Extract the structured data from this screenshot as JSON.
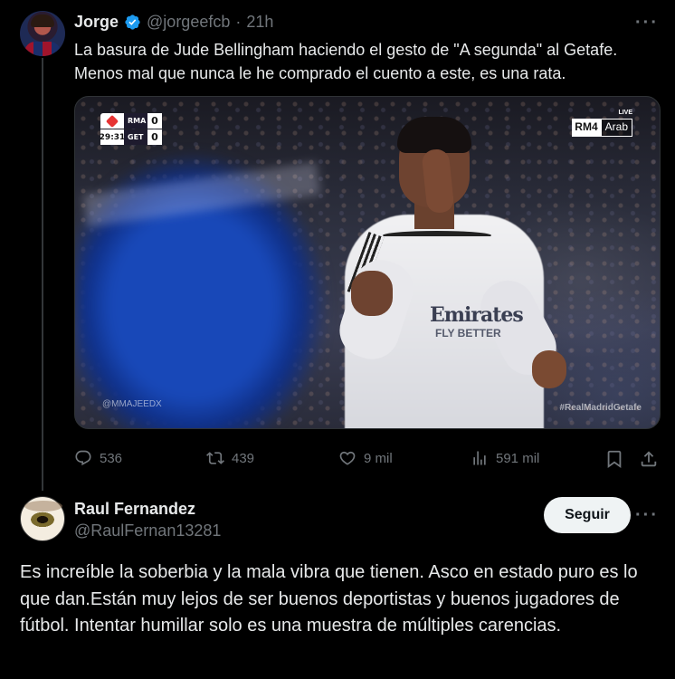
{
  "parent_tweet": {
    "author_name": "Jorge",
    "handle": "@jorgeefcb",
    "separator": "·",
    "time": "21h",
    "more": "···",
    "text": "La basura de Jude Bellingham haciendo el gesto de \"A segunda\" al Getafe. Menos mal que nunca le he comprado el cuento a este, es una rata.",
    "media": {
      "scorebug": {
        "time": "29:31",
        "team1": "RMA",
        "score1": "0",
        "team2": "GET",
        "score2": "0"
      },
      "channel_a": "RM4",
      "channel_b": "Arab",
      "live": "LIVE",
      "jersey_text": "Emirates",
      "jersey_sub": "FLY BETTER",
      "watermark_left": "@MMAJEEDX",
      "watermark_right": "#RealMadridGetafe"
    },
    "actions": {
      "replies": "536",
      "reposts": "439",
      "likes": "9 mil",
      "views": "591 mil"
    }
  },
  "reply_tweet": {
    "author_name": "Raul Fernandez",
    "handle": "@RaulFernan13281",
    "follow_label": "Seguir",
    "more": "···",
    "text": "Es increíble la soberbia y la mala vibra que tienen. Asco en estado puro es lo que dan.Están muy lejos de ser buenos deportistas y buenos jugadores de fútbol. Intentar humillar solo es una muestra de múltiples carencias."
  },
  "colors": {
    "background": "#000000",
    "text": "#e7e9ea",
    "muted": "#71767b",
    "verified": "#1d9bf0",
    "follow_bg": "#eff3f4"
  }
}
